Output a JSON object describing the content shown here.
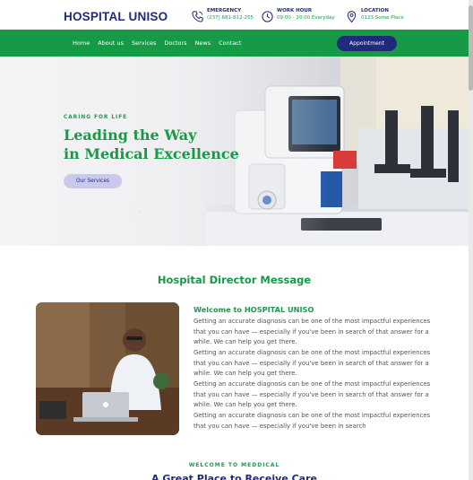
{
  "header": {
    "logo": "HOSPITAL UNISO",
    "emergency": {
      "label": "EMERGENCY",
      "value": "(237) 681-812-255"
    },
    "work_hour": {
      "label": "WORK HOUR",
      "value": "09:00 - 20:00 Everyday"
    },
    "location": {
      "label": "LOCATION",
      "value": "0123 Some Place"
    }
  },
  "nav": {
    "items": [
      "Home",
      "About us",
      "Services",
      "Doctors",
      "News",
      "Contact"
    ],
    "appointment": "Appointment"
  },
  "hero": {
    "eyebrow": "CARING FOR LIFE",
    "title_line1": "Leading the Way",
    "title_line2": "in Medical Excellence",
    "button": "Our Services"
  },
  "director": {
    "section_title": "Hospital Director Message",
    "welcome": "Welcome to HOSPITAL UNISO",
    "paragraphs": [
      "Getting an accurate diagnosis can be one of the most impactful experiences that you can have — especially if you've been in search of that answer for a while. We can help you get there.",
      "Getting an accurate diagnosis can be one of the most impactful experiences that you can have — especially if you've been in search of that answer for a while. We can help you get there.",
      "Getting an accurate diagnosis can be one of the most impactful experiences that you can have — especially if you've been in search of that answer for a while. We can help you get there.",
      "Getting an accurate diagnosis can be one of the most impactful experiences that you can have — especially if you've been in search"
    ]
  },
  "welcome_section": {
    "eyebrow": "WELCOME TO MEDDICAL",
    "title": "A Great Place to Receive Care"
  },
  "colors": {
    "brand_green": "#169a45",
    "brand_navy": "#1f2a7a"
  }
}
